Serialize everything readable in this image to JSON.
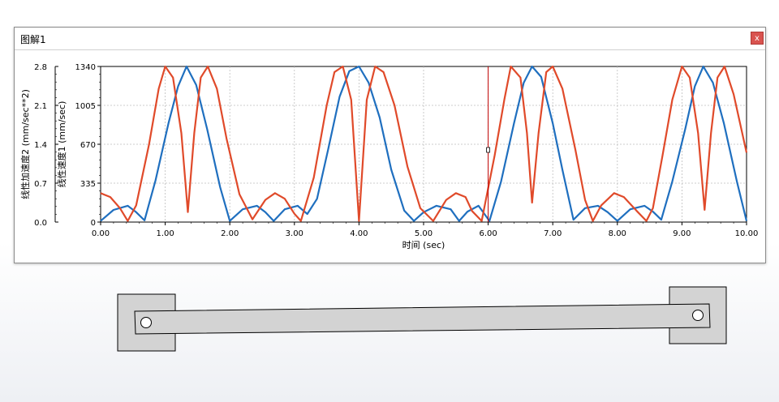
{
  "window": {
    "title": "图解1",
    "close_label": "x"
  },
  "chart_data": {
    "type": "line",
    "xlabel": "时间 (sec)",
    "xlim": [
      0,
      10
    ],
    "x_ticks": [
      "0.00",
      "1.00",
      "2.00",
      "3.00",
      "4.00",
      "5.00",
      "6.00",
      "7.00",
      "8.00",
      "9.00",
      "10.00"
    ],
    "y_left_outer": {
      "label": "线性加速度2 (mm/sec**2)",
      "lim": [
        0,
        2.8
      ],
      "ticks": [
        "0.0",
        "0.7",
        "1.4",
        "2.1",
        "2.8"
      ]
    },
    "y_left_inner": {
      "label": "线性速度1 (mm/sec)",
      "lim": [
        0,
        1340
      ],
      "ticks": [
        "0",
        "335",
        "670",
        "1005",
        "1340"
      ]
    },
    "grid": true,
    "cursor_x": 6.0,
    "series": [
      {
        "color": "#1f6fbf",
        "axis": "y_left_inner",
        "x": [
          0,
          0.2,
          0.42,
          0.55,
          0.68,
          0.85,
          1.05,
          1.2,
          1.33,
          1.48,
          1.65,
          1.85,
          2.0,
          2.2,
          2.42,
          2.55,
          2.68,
          2.85,
          3.05,
          3.2,
          3.35,
          3.52,
          3.7,
          3.85,
          4.0,
          4.15,
          4.32,
          4.5,
          4.7,
          4.85,
          5.0,
          5.2,
          5.42,
          5.55,
          5.68,
          5.85,
          6.02,
          6.2,
          6.4,
          6.55,
          6.68,
          6.82,
          7.0,
          7.15,
          7.32,
          7.5,
          7.7,
          7.85,
          8.0,
          8.2,
          8.42,
          8.55,
          8.68,
          8.85,
          9.05,
          9.2,
          9.33,
          9.48,
          9.65,
          9.85,
          10.0
        ],
        "y": [
          10,
          105,
          140,
          85,
          15,
          360,
          850,
          1170,
          1340,
          1180,
          800,
          300,
          10,
          110,
          140,
          85,
          10,
          110,
          140,
          70,
          200,
          620,
          1080,
          1300,
          1340,
          1200,
          900,
          450,
          100,
          10,
          85,
          140,
          110,
          10,
          90,
          140,
          10,
          350,
          850,
          1200,
          1340,
          1250,
          850,
          450,
          20,
          120,
          140,
          85,
          10,
          110,
          140,
          90,
          20,
          350,
          800,
          1170,
          1340,
          1200,
          850,
          350,
          10
        ]
      },
      {
        "color": "#e04a2a",
        "axis": "y_left_outer",
        "x": [
          0,
          0.15,
          0.3,
          0.42,
          0.55,
          0.75,
          0.9,
          1.0,
          1.12,
          1.25,
          1.35,
          1.45,
          1.55,
          1.66,
          1.8,
          1.95,
          2.15,
          2.35,
          2.55,
          2.7,
          2.85,
          3.0,
          3.1,
          3.3,
          3.5,
          3.62,
          3.75,
          3.88,
          4.0,
          4.12,
          4.25,
          4.38,
          4.55,
          4.75,
          4.95,
          5.15,
          5.35,
          5.5,
          5.65,
          5.75,
          5.9,
          6.1,
          6.25,
          6.35,
          6.5,
          6.6,
          6.68,
          6.78,
          6.9,
          7.0,
          7.15,
          7.35,
          7.5,
          7.62,
          7.75,
          7.95,
          8.1,
          8.3,
          8.45,
          8.55,
          8.7,
          8.85,
          9.0,
          9.12,
          9.25,
          9.35,
          9.45,
          9.55,
          9.66,
          9.8,
          10.0
        ],
        "y": [
          0.52,
          0.45,
          0.25,
          0.02,
          0.3,
          1.4,
          2.4,
          2.8,
          2.6,
          1.6,
          0.18,
          1.6,
          2.6,
          2.8,
          2.4,
          1.5,
          0.5,
          0.05,
          0.4,
          0.52,
          0.42,
          0.15,
          0.02,
          0.8,
          2.1,
          2.7,
          2.8,
          2.2,
          0.02,
          2.2,
          2.8,
          2.7,
          2.1,
          1.0,
          0.25,
          0.02,
          0.4,
          0.52,
          0.45,
          0.2,
          0.02,
          1.2,
          2.2,
          2.8,
          2.6,
          1.6,
          0.35,
          1.6,
          2.7,
          2.8,
          2.4,
          1.3,
          0.4,
          0.02,
          0.3,
          0.52,
          0.45,
          0.2,
          0.02,
          0.25,
          1.2,
          2.2,
          2.8,
          2.6,
          1.6,
          0.22,
          1.6,
          2.6,
          2.8,
          2.3,
          1.25
        ]
      }
    ]
  },
  "model": {
    "fill_color": "#d3d3d3",
    "stroke_color": "#000000"
  }
}
